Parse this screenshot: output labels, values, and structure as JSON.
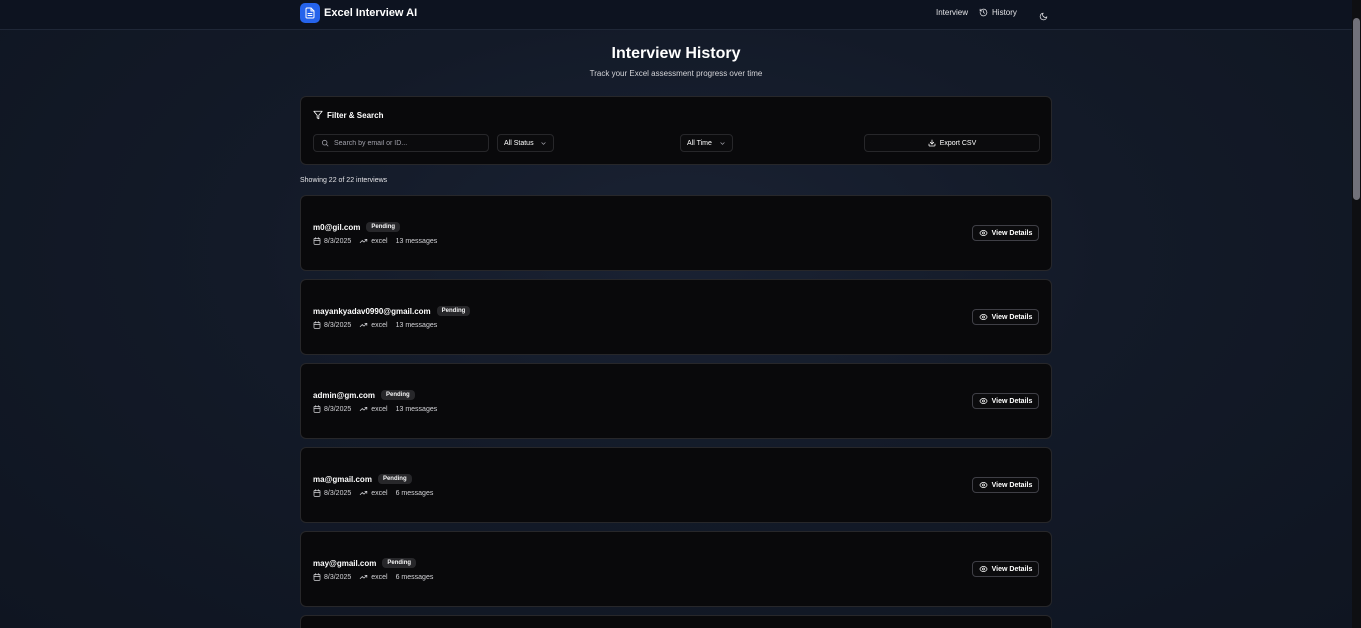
{
  "app": {
    "name": "Excel Interview AI"
  },
  "nav": {
    "interview_label": "Interview",
    "history_label": "History"
  },
  "header": {
    "title": "Interview History",
    "subtitle": "Track your Excel assessment progress over time"
  },
  "filters": {
    "title": "Filter & Search",
    "search_placeholder": "Search by email or ID...",
    "status_value": "All Status",
    "time_value": "All Time",
    "export_label": "Export CSV"
  },
  "results": {
    "summary": "Showing 22 of 22 interviews"
  },
  "interviews": [
    {
      "email": "m0@gil.com",
      "status": "Pending",
      "date": "8/3/2025",
      "category": "excel",
      "messages": "13 messages"
    },
    {
      "email": "mayankyadav0990@gmail.com",
      "status": "Pending",
      "date": "8/3/2025",
      "category": "excel",
      "messages": "13 messages"
    },
    {
      "email": "admin@gm.com",
      "status": "Pending",
      "date": "8/3/2025",
      "category": "excel",
      "messages": "13 messages"
    },
    {
      "email": "ma@gmail.com",
      "status": "Pending",
      "date": "8/3/2025",
      "category": "excel",
      "messages": "6 messages"
    },
    {
      "email": "may@gmail.com",
      "status": "Pending",
      "date": "8/3/2025",
      "category": "excel",
      "messages": "6 messages"
    }
  ],
  "actions": {
    "view_details_label": "View Details"
  },
  "colors": {
    "accent": "#2563eb",
    "card_bg": "#09090b",
    "border": "#27272a",
    "page_bg": "#131a28"
  },
  "icons": {
    "logo": "document-icon",
    "history": "history-icon",
    "theme": "moon-icon",
    "filter": "filter-icon",
    "search": "search-icon",
    "chevron": "chevron-down-icon",
    "export": "download-icon",
    "date": "calendar-icon",
    "category": "trending-up-icon",
    "view": "eye-icon"
  }
}
